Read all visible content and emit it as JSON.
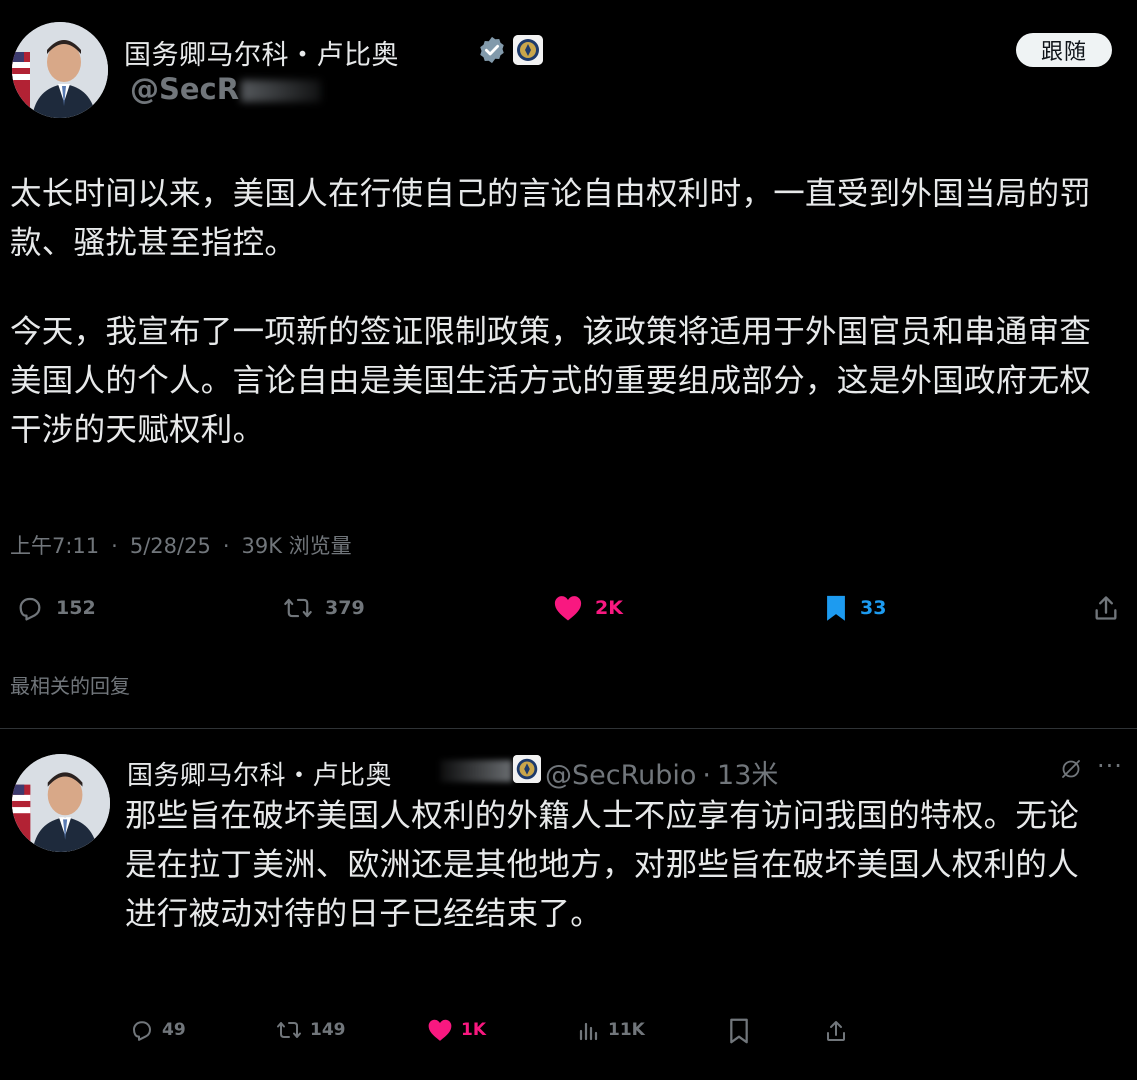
{
  "main_tweet": {
    "display_name": "国务卿马尔科・卢比奥",
    "handle_visible": "@SecR",
    "follow_label": "跟随",
    "paragraphs": [
      "太长时间以来，美国人在行使自己的言论自由权利时，一直受到外国当局的罚款、骚扰甚至指控。",
      "今天，我宣布了一项新的签证限制政策，该政策将适用于外国官员和串通审查美国人的个人。言论自由是美国生活方式的重要组成部分，这是外国政府无权干涉的天赋权利。"
    ],
    "time": "上午7:11",
    "date": "5/28/25",
    "views": "39K 浏览量",
    "actions": {
      "replies": "152",
      "retweets": "379",
      "likes": "2K",
      "bookmarks": "33"
    },
    "colors": {
      "like": "#f91880",
      "bookmark": "#1d9bf0"
    },
    "icons": [
      "verified-badge-icon",
      "state-department-seal-icon",
      "reply-icon",
      "retweet-icon",
      "heart-icon",
      "bookmark-icon",
      "share-icon"
    ]
  },
  "relevant_replies_label": "最相关的回复",
  "reply_tweet": {
    "display_name": "国务卿马尔科・卢比奥",
    "handle": "@SecRubio",
    "time_ago": "13米",
    "text": "那些旨在破坏美国人权利的外籍人士不应享有访问我国的特权。无论是在拉丁美洲、欧洲还是其他地方，对那些旨在破坏美国人权利的人进行被动对待的日子已经结束了。",
    "more_label": "···",
    "actions": {
      "replies": "49",
      "retweets": "149",
      "likes": "1K",
      "views": "11K"
    },
    "icons": [
      "grok-icon",
      "more-icon",
      "reply-icon",
      "retweet-icon",
      "heart-icon",
      "views-icon",
      "bookmark-icon",
      "share-icon"
    ]
  }
}
